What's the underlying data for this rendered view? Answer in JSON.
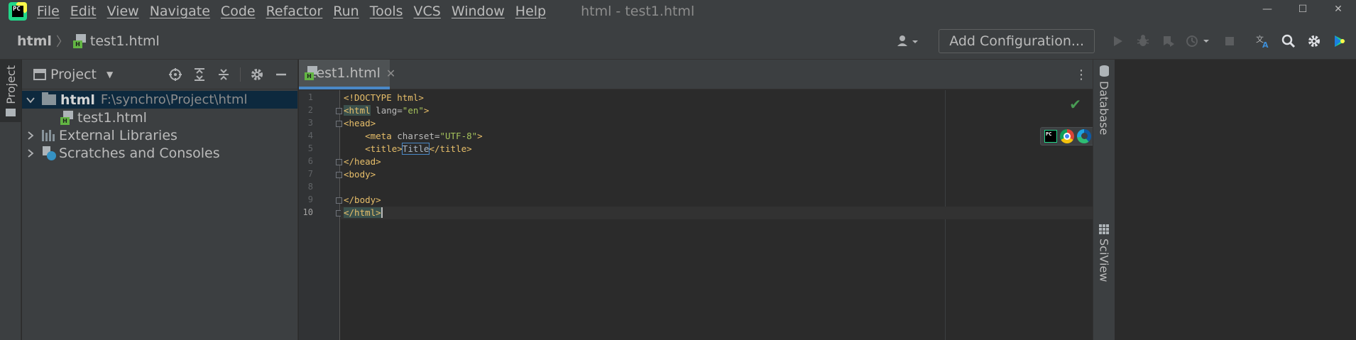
{
  "menubar": {
    "app_logo_text": "PC",
    "items": [
      "File",
      "Edit",
      "View",
      "Navigate",
      "Code",
      "Refactor",
      "Run",
      "Tools",
      "VCS",
      "Window",
      "Help"
    ],
    "window_title": "html - test1.html",
    "controls": {
      "minimize": "—",
      "maximize": "☐",
      "close": "✕"
    }
  },
  "navbar": {
    "breadcrumb_root": "html",
    "breadcrumb_sep": "〉",
    "breadcrumb_file": "test1.html",
    "file_icon_tag": "H",
    "add_configuration_label": "Add Configuration...",
    "icons": [
      "account-icon",
      "run-icon",
      "debug-icon",
      "coverage-icon",
      "profile-icon",
      "stop-icon",
      "translate-icon",
      "search-icon",
      "settings-icon",
      "toolbox-icon"
    ]
  },
  "left_strip": {
    "project_tab": "Project"
  },
  "project_panel": {
    "title": "Project",
    "dropdown": "▼",
    "tree": {
      "root_name": "html",
      "root_path": "F:\\synchro\\Project\\html",
      "file": "test1.html",
      "external_libraries": "External Libraries",
      "scratches": "Scratches and Consoles"
    }
  },
  "editor": {
    "tab_label": "test1.html",
    "tab_close": "✕",
    "more": "⋮",
    "check": "✔",
    "line_numbers": [
      "1",
      "2",
      "3",
      "4",
      "5",
      "6",
      "7",
      "8",
      "9",
      "10"
    ],
    "code": {
      "l1_tag": "<!DOCTYPE",
      "l1_rest": " html>",
      "l2_open": "<html",
      "l2_attr": " lang=",
      "l2_val": "\"en\"",
      "l2_close": ">",
      "l3": "<head>",
      "l4_indent": "    ",
      "l4_open": "<meta",
      "l4_attr": " charset=",
      "l4_val": "\"UTF-8\"",
      "l4_close": ">",
      "l5_indent": "    ",
      "l5_open": "<title>",
      "l5_text": "Title",
      "l5_close": "</title>",
      "l6": "</head>",
      "l7": "<body>",
      "l8": "",
      "l9": "</body>",
      "l10": "</html>"
    },
    "browser_popup": {
      "pc_label": "PC"
    }
  },
  "right_strip": {
    "database_tab": "Database",
    "sciview_tab": "SciView"
  },
  "colors": {
    "background": "#2b2b2b",
    "panel": "#3c3f41",
    "selection": "#0d293e",
    "tag": "#e8bf6a",
    "attr_value": "#a5c25c",
    "accent": "#4a88c7"
  }
}
